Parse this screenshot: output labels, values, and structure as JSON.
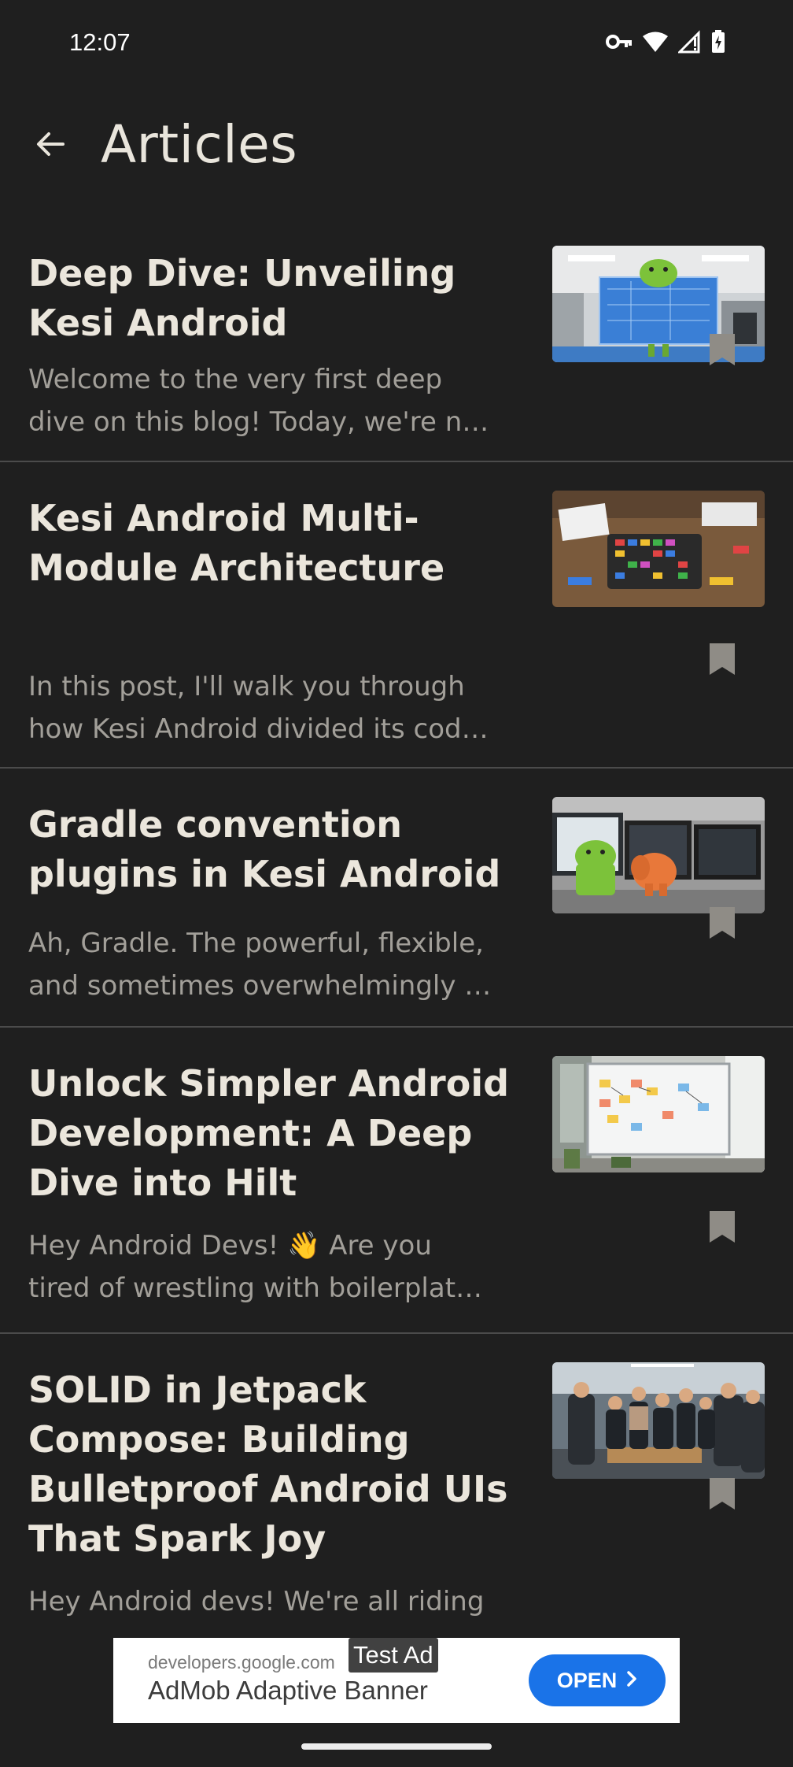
{
  "status_bar": {
    "time": "12:07",
    "icons": [
      "vpn-key-icon",
      "wifi-icon",
      "cell-signal-icon",
      "battery-charging-icon"
    ]
  },
  "app_bar": {
    "back_icon": "arrow-back-icon",
    "title": "Articles"
  },
  "articles": [
    {
      "title": "Deep Dive: Unveiling Kesi Android",
      "excerpt_lines": [
        "Welcome to the very first deep",
        "dive on this blog! Today, we're n…"
      ],
      "thumbnail": "android-robot-blueprint-office-image",
      "bookmark_icon": "bookmark-icon"
    },
    {
      "title": "Kesi Android Multi-Module Architecture",
      "excerpt_lines": [
        "In this post, I'll walk you through",
        "how Kesi Android divided its cod…"
      ],
      "thumbnail": "modular-bricks-workbench-image",
      "bookmark_icon": "bookmark-icon"
    },
    {
      "title": "Gradle convention plugins in Kesi Android",
      "excerpt_lines": [
        "Ah, Gradle. The powerful, flexible,",
        "and sometimes overwhelmingly …"
      ],
      "thumbnail": "android-and-gradle-elephant-desk-image",
      "bookmark_icon": "bookmark-icon"
    },
    {
      "title": "Unlock Simpler Android Development: A Deep Dive into Hilt",
      "excerpt_lines": [
        "Hey Android Devs! 👋 Are you",
        "tired of wrestling with boilerplat…"
      ],
      "thumbnail": "whiteboard-sticky-notes-image",
      "bookmark_icon": "bookmark-icon"
    },
    {
      "title": "SOLID in Jetpack Compose: Building Bulletproof Android UIs That Spark Joy",
      "excerpt_lines": [
        "Hey Android devs! We're all riding"
      ],
      "thumbnail": "team-around-book-image",
      "bookmark_icon": "bookmark-icon"
    }
  ],
  "ad": {
    "domain": "developers.google.com",
    "badge": "Test Ad",
    "title": "AdMob Adaptive Banner",
    "button_label": "OPEN",
    "button_color": "#1a73e8"
  },
  "colors": {
    "background": "#1f1f1f",
    "title_text": "#ebe6dc",
    "excerpt_text": "#a29f99",
    "divider": "#4b4b4b",
    "bookmark": "#8f8c86"
  }
}
